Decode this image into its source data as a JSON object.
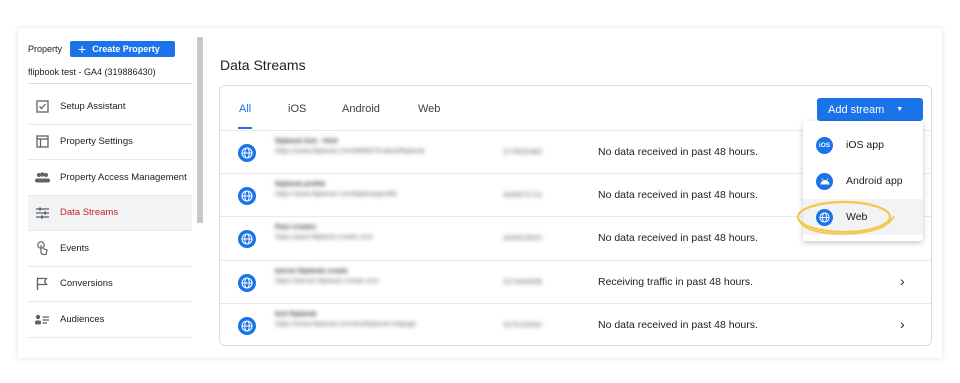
{
  "sidebar": {
    "property_label": "Property",
    "create_property_label": "Create Property",
    "property_name": "flipbook test - GA4 (319886430)",
    "items": [
      {
        "label": "Setup Assistant",
        "icon": "checklist-icon",
        "active": false
      },
      {
        "label": "Property Settings",
        "icon": "property-settings-icon",
        "active": false
      },
      {
        "label": "Property Access Management",
        "icon": "people-icon",
        "active": false
      },
      {
        "label": "Data Streams",
        "icon": "data-streams-icon",
        "active": true
      },
      {
        "label": "Events",
        "icon": "touch-icon",
        "active": false
      },
      {
        "label": "Conversions",
        "icon": "flag-icon",
        "active": false
      },
      {
        "label": "Audiences",
        "icon": "audiences-icon",
        "active": false
      }
    ]
  },
  "main": {
    "title": "Data Streams",
    "tabs": [
      {
        "label": "All",
        "active": true
      },
      {
        "label": "iOS",
        "active": false
      },
      {
        "label": "Android",
        "active": false
      },
      {
        "label": "Web",
        "active": false
      }
    ],
    "add_stream_label": "Add stream",
    "streams": [
      {
        "name": "flipbook test - html",
        "url": "https://www.flipbook.com/8865079-abcd/flipbook",
        "id": "3778002960",
        "status": "No data received in past 48 hours.",
        "chevron": false
      },
      {
        "name": "flipbook profile",
        "url": "https://www.flipbook.com/flipbookprofile",
        "id": "4046672714",
        "status": "No data received in past 48 hours.",
        "chevron": false
      },
      {
        "name": "Paul creates",
        "url": "https://paul-flipbook-create.com",
        "id": "4426419010",
        "status": "No data received in past 48 hours.",
        "chevron": false
      },
      {
        "name": "bernie flipbook create",
        "url": "https://bernie-flipbook-create.com",
        "id": "3274633638",
        "status": "Receiving traffic in past 48 hours.",
        "chevron": true
      },
      {
        "name": "test flipbook",
        "url": "https://www.flipbook.com/testflipbook-fullpage",
        "id": "3275155563",
        "status": "No data received in past 48 hours.",
        "chevron": true
      }
    ]
  },
  "dropdown": {
    "items": [
      {
        "label": "iOS app",
        "icon": "ios-icon",
        "highlighted": false
      },
      {
        "label": "Android app",
        "icon": "android-icon",
        "highlighted": false
      },
      {
        "label": "Web",
        "icon": "globe-icon",
        "highlighted": true
      }
    ]
  },
  "colors": {
    "accent": "#1a73e8",
    "active_nav": "#c5221f",
    "highlight_ring": "#f2c94c"
  }
}
